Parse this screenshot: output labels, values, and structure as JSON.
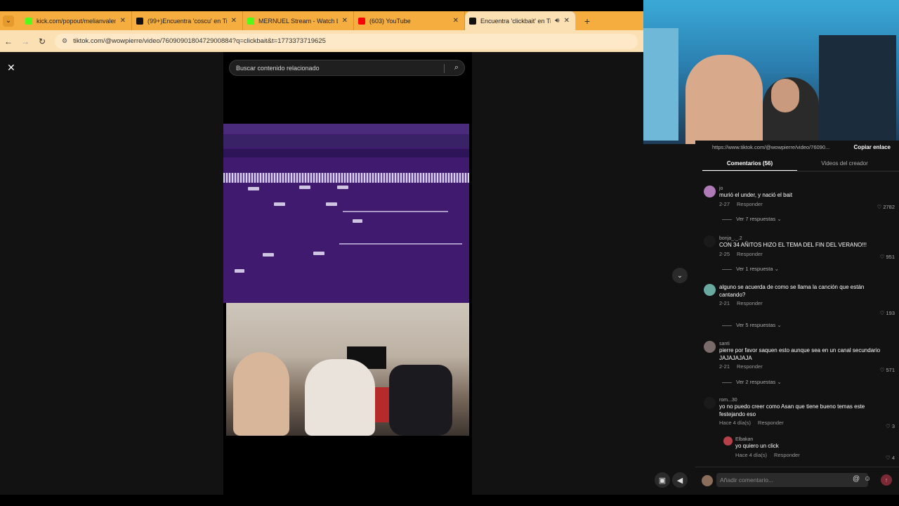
{
  "browser": {
    "tabs": [
      {
        "label": "kick.com/popout/melianvalen/c",
        "favicon_color": "#53fc18"
      },
      {
        "label": "(99+)Encuentra 'coscu' en TikTo",
        "favicon_color": "#111111"
      },
      {
        "label": "MERNUEL Stream - Watch Live",
        "favicon_color": "#53fc18"
      },
      {
        "label": "(603) YouTube",
        "favicon_color": "#ff0000"
      },
      {
        "label": "Encuentra 'clickbait' en TikTo",
        "favicon_color": "#111111"
      }
    ],
    "url": "tiktok.com/@wowpierre/video/7609090180472900884?q=clickbait&t=1773373719625"
  },
  "tiktok": {
    "search_placeholder": "Buscar contenido relacionado",
    "share_link": "https://www.tiktok.com/@wowpierre/video/76090...",
    "copy_link": "Copiar enlace",
    "tab_comments": "Comentarios (56)",
    "tab_creator": "Videos del creador",
    "comments": [
      {
        "user": "jo",
        "text": "murió el under, y nació el bait",
        "date": "2-27",
        "reply": "Responder",
        "likes": "2782",
        "replies": "Ver 7 respuestas",
        "avatar_color": "#b07ab8"
      },
      {
        "user": "bonja_._.2",
        "text": "CON 34 AÑITOS HIZO EL TEMA DEL FIN DEL VERANO!!!",
        "date": "2-25",
        "reply": "Responder",
        "likes": "951",
        "replies": "Ver 1 respuesta",
        "avatar_color": "#1a1a1a"
      },
      {
        "user": "",
        "text": "alguno se acuerda de como se llama la canción que están cantando?",
        "date": "2-21",
        "reply": "Responder",
        "likes": "193",
        "replies": "Ver 5 respuestas",
        "avatar_color": "#6aa9a0"
      },
      {
        "user": "santi",
        "text": "pierre por favor saquen esto aunque sea en un canal secundario JAJAJAJAJA",
        "date": "2-21",
        "reply": "Responder",
        "likes": "571",
        "replies": "Ver 2 respuestas",
        "avatar_color": "#7a6a6a"
      },
      {
        "user": "rom...30",
        "text": "yo no puedo creer como Asan que tiene bueno temas este festejando eso",
        "date": "Hace 4 día(s)",
        "reply": "Responder",
        "likes": "3",
        "replies": "",
        "avatar_color": "#1a1a1a"
      }
    ],
    "nested_reply": {
      "user": "Elbakan",
      "text": "yo quiero un click",
      "date": "Hace 4 día(s)",
      "reply": "Responder",
      "likes": "4",
      "avatar_color": "#b8404a"
    },
    "comment_placeholder": "Añadir comentario..."
  }
}
